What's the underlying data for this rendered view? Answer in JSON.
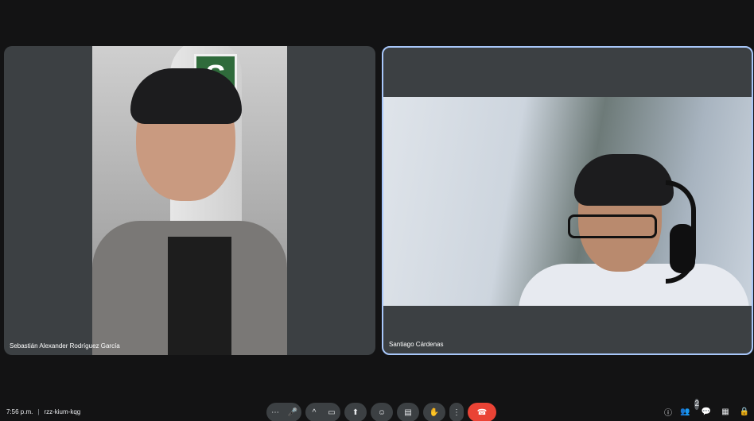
{
  "participants": [
    {
      "name": "Sebastián Alexander Rodríguez García"
    },
    {
      "name": "Santiago Cárdenas"
    }
  ],
  "background": {
    "logo_letter": "S"
  },
  "meeting": {
    "time": "7:56 p.m.",
    "separator": "|",
    "code": "rzz-kium-kqg"
  },
  "controls": {
    "more_audio": "⋯",
    "mic": "🎤",
    "chevron": "^",
    "camera": "▭",
    "present": "⬆",
    "emoji": "☺",
    "captions": "▤",
    "raise_hand": "✋",
    "more_options": "⋮",
    "end_call": "☎"
  },
  "right_icons": {
    "info": "ⓘ",
    "people": "👥",
    "people_count": "2",
    "chat": "💬",
    "activities": "▦",
    "host_controls": "🔒"
  },
  "colors": {
    "tile": "#3c4043",
    "end_call": "#ea4335",
    "active_border": "#a8c7fa"
  }
}
